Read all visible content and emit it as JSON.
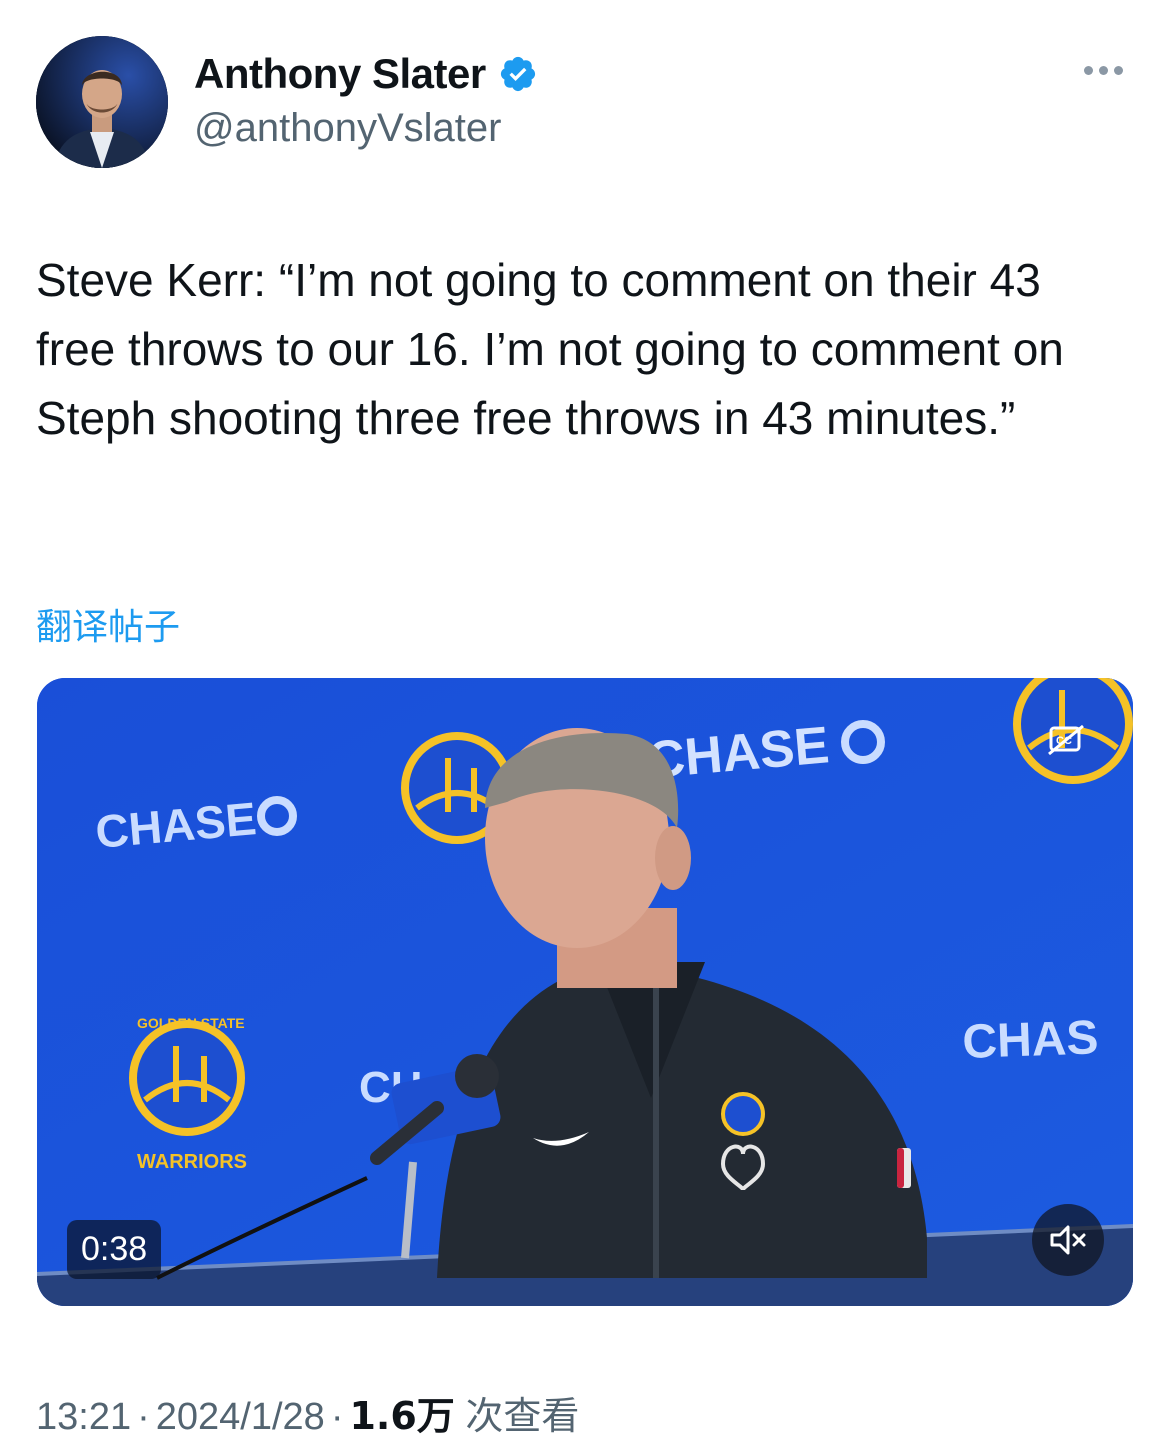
{
  "author": {
    "name": "Anthony Slater",
    "handle": "@anthonyVslater",
    "verified_color": "#1d9bf0"
  },
  "tweet": {
    "text": "Steve Kerr: “I’m not going to comment on their 43 free throws to our 16. I’m not going to comment on Steph shooting three free throws in 43 minutes.”",
    "translate_label": "翻译帖子"
  },
  "video": {
    "duration": "0:38",
    "backdrop_text": [
      "CHASE",
      "CHASE",
      "CHAS",
      "CH"
    ],
    "logo_text": [
      "GOLDEN STATE",
      "WARRIORS"
    ],
    "icons": {
      "mute": "speaker-muted-icon",
      "captions": "closed-captions-icon"
    }
  },
  "meta": {
    "time": "13:21",
    "date": "2024/1/28",
    "views_count": "1.6万",
    "views_label": "次查看",
    "separator": "·"
  },
  "colors": {
    "accent": "#1d9bf0",
    "text_primary": "#0f1419",
    "text_secondary": "#536471",
    "video_blue": "#1b4fd6"
  }
}
